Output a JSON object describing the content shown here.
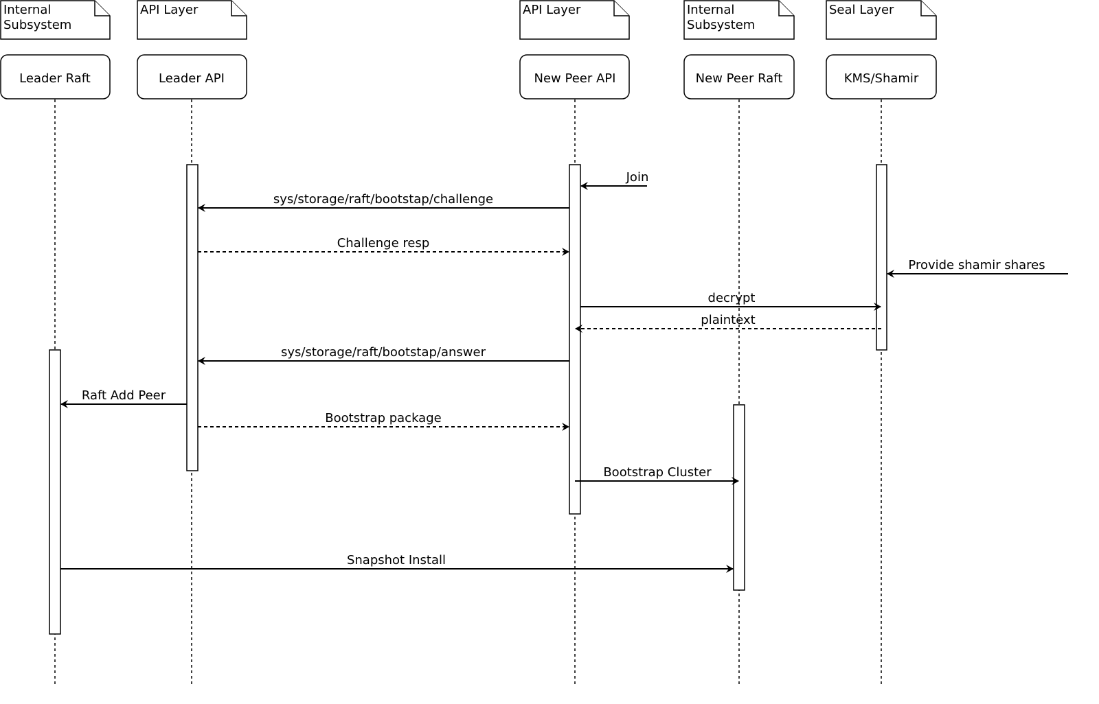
{
  "participants": [
    {
      "name": "Leader Raft",
      "note": [
        "Internal",
        "Subsystem"
      ]
    },
    {
      "name": "Leader API",
      "note": [
        "API Layer"
      ]
    },
    {
      "name": "New Peer API",
      "note": [
        "API Layer"
      ]
    },
    {
      "name": "New Peer Raft",
      "note": [
        "Internal",
        "Subsystem"
      ]
    },
    {
      "name": "KMS/Shamir",
      "note": [
        "Seal Layer"
      ]
    }
  ],
  "messages": [
    {
      "label": "Join",
      "from": "external",
      "to": "New Peer API",
      "style": "solid"
    },
    {
      "label": "sys/storage/raft/bootstap/challenge",
      "from": "New Peer API",
      "to": "Leader API",
      "style": "solid"
    },
    {
      "label": "Challenge resp",
      "from": "Leader API",
      "to": "New Peer API",
      "style": "dashed"
    },
    {
      "label": "Provide shamir shares",
      "from": "external",
      "to": "KMS/Shamir",
      "style": "solid"
    },
    {
      "label": "decrypt",
      "from": "New Peer API",
      "to": "KMS/Shamir",
      "style": "solid"
    },
    {
      "label": "plaintext",
      "from": "KMS/Shamir",
      "to": "New Peer API",
      "style": "dashed"
    },
    {
      "label": "sys/storage/raft/bootstap/answer",
      "from": "New Peer API",
      "to": "Leader API",
      "style": "solid"
    },
    {
      "label": "Raft Add Peer",
      "from": "Leader API",
      "to": "Leader Raft",
      "style": "solid"
    },
    {
      "label": "Bootstrap package",
      "from": "Leader API",
      "to": "New Peer API",
      "style": "dashed"
    },
    {
      "label": "Bootstrap Cluster",
      "from": "New Peer API",
      "to": "New Peer Raft",
      "style": "solid"
    },
    {
      "label": "Snapshot Install",
      "from": "Leader Raft",
      "to": "New Peer Raft",
      "style": "solid"
    }
  ]
}
